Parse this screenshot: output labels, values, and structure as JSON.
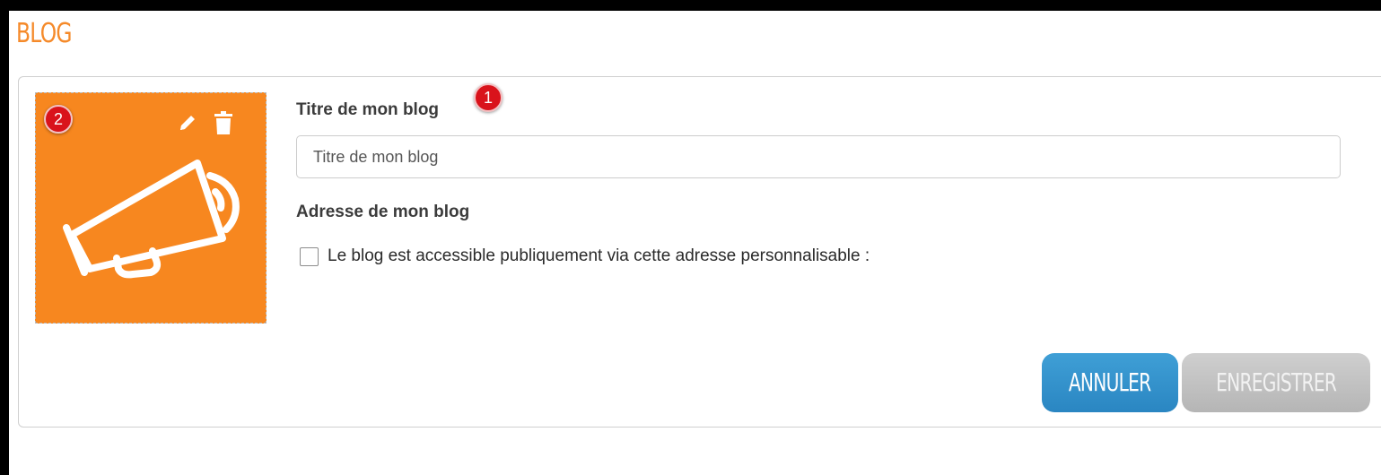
{
  "page": {
    "title": "BLOG"
  },
  "thumbnail": {
    "badge": "2",
    "icon": "megaphone-icon",
    "background_color": "#f7871f",
    "tools": {
      "edit_icon": "pencil-icon",
      "delete_icon": "trash-icon"
    }
  },
  "form": {
    "title_label": "Titre de mon blog",
    "title_badge": "1",
    "title_input": {
      "value": "",
      "placeholder": "Titre de mon blog"
    },
    "address_label": "Adresse de mon blog",
    "public_checkbox": {
      "checked": false,
      "label": "Le blog est accessible publiquement via cette adresse personnalisable :"
    }
  },
  "actions": {
    "cancel_label": "ANNULER",
    "save_label": "ENREGISTRER",
    "cancel_color": "#2a86c2",
    "save_color": "#b5b5b5"
  }
}
